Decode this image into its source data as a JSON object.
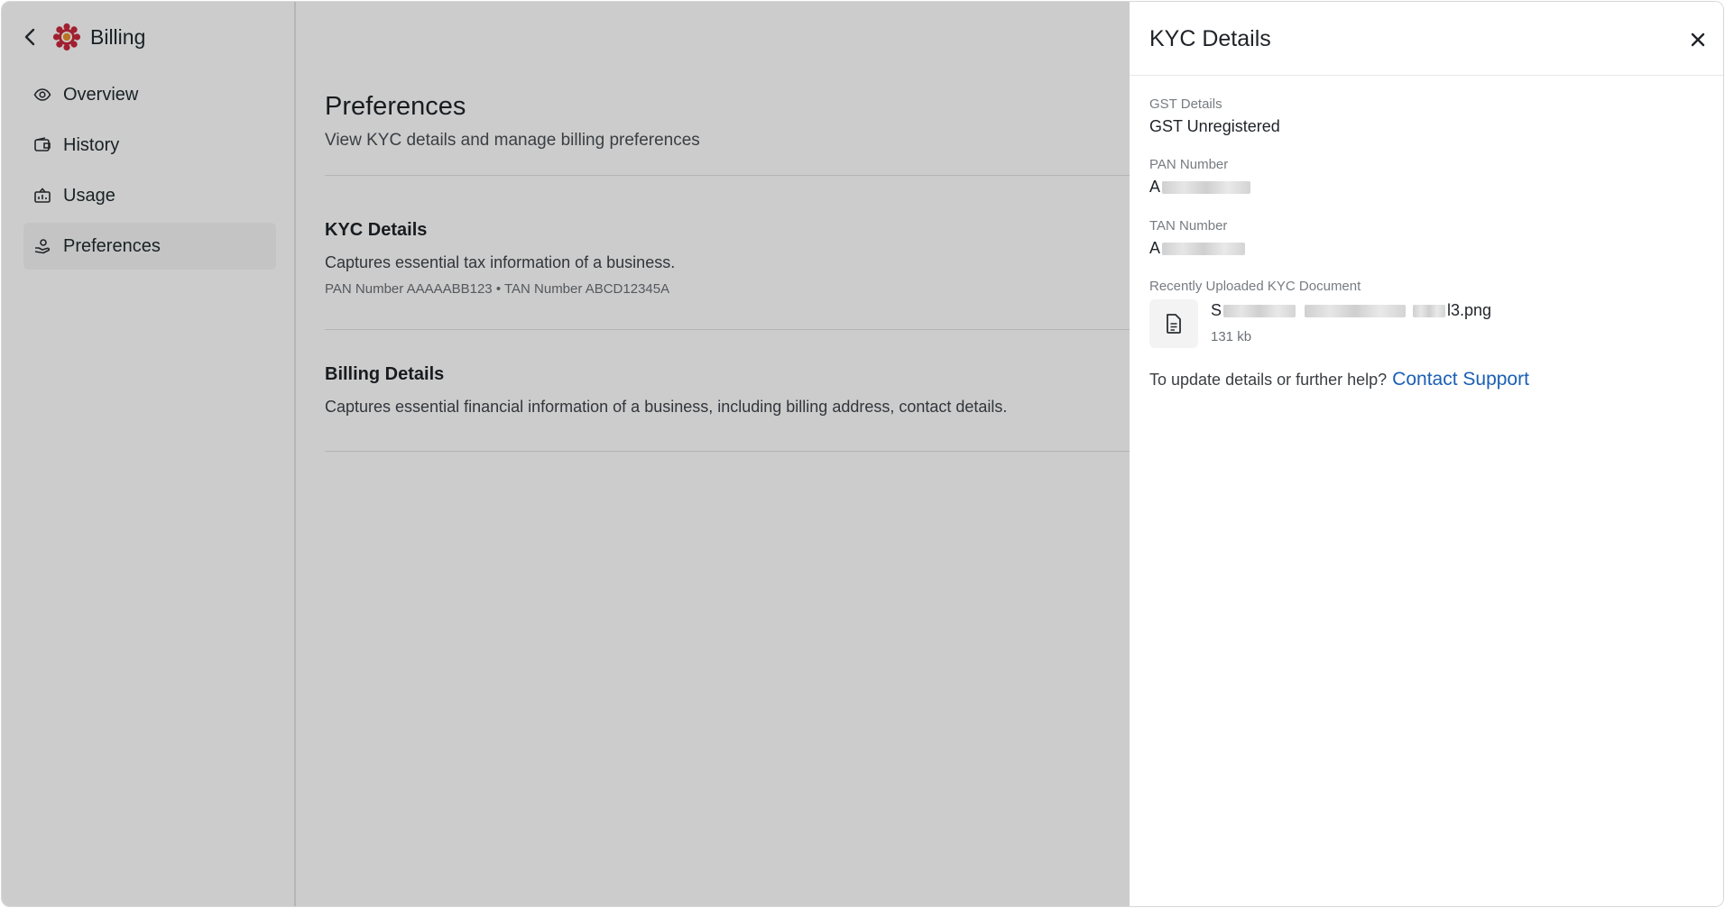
{
  "sidebar": {
    "title": "Billing",
    "items": [
      {
        "label": "Overview",
        "icon": "eye-icon"
      },
      {
        "label": "History",
        "icon": "wallet-icon"
      },
      {
        "label": "Usage",
        "icon": "usage-icon"
      },
      {
        "label": "Preferences",
        "icon": "preferences-icon",
        "active": true
      }
    ]
  },
  "main": {
    "title": "Preferences",
    "subtitle": "View KYC details and manage billing preferences",
    "sections": [
      {
        "title": "KYC Details",
        "description": "Captures essential tax information of a business.",
        "meta": "PAN Number AAAAABB123 • TAN Number ABCD12345A"
      },
      {
        "title": "Billing Details",
        "description": "Captures essential financial information of a business, including billing address, contact details."
      }
    ]
  },
  "drawer": {
    "title": "KYC Details",
    "gst": {
      "label": "GST Details",
      "value": "GST Unregistered"
    },
    "pan": {
      "label": "PAN Number",
      "value": "A"
    },
    "tan": {
      "label": "TAN Number",
      "value": "A"
    },
    "document": {
      "label": "Recently Uploaded KYC Document",
      "name_start": "S",
      "name_end": "l3.png",
      "size": "131 kb"
    },
    "help": {
      "text": "To update details or further help?",
      "link": "Contact Support"
    }
  },
  "colors": {
    "link": "#1a5fb4",
    "logo_red": "#c8283c",
    "logo_orange": "#e8922e",
    "overlay": "rgba(0,0,0,0.2)"
  }
}
